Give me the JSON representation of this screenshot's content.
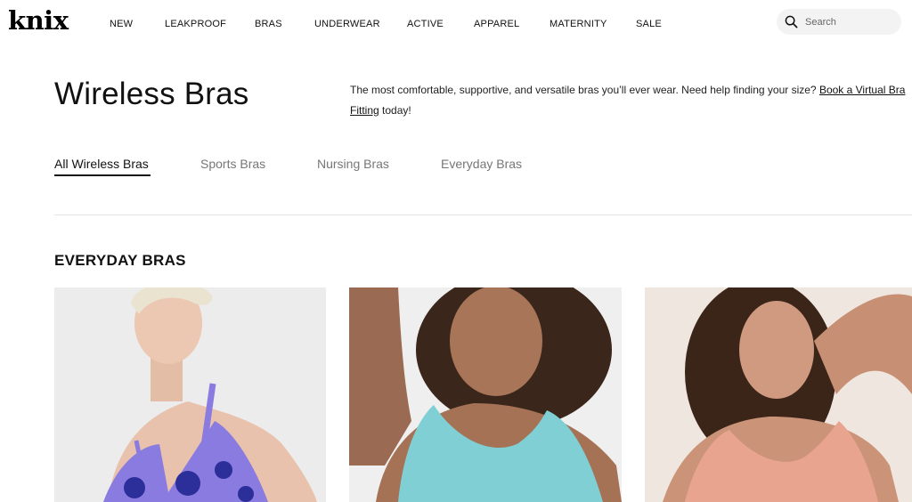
{
  "header": {
    "logo": "knix",
    "nav": [
      "NEW",
      "LEAKPROOF",
      "BRAS",
      "UNDERWEAR",
      "ACTIVE",
      "APPAREL",
      "MATERNITY",
      "SALE"
    ],
    "search": {
      "placeholder": "Search",
      "icon": "search-icon"
    }
  },
  "page": {
    "title": "Wireless Bras",
    "description_prefix": "The most comfortable, supportive, and versatile bras you’ll ever wear. Need help finding your size? ",
    "description_link": "Book a Virtual Bra Fitting",
    "description_suffix": " today!"
  },
  "tabs": [
    {
      "label": "All Wireless Bras",
      "active": true
    },
    {
      "label": "Sports Bras",
      "active": false
    },
    {
      "label": "Nursing Bras",
      "active": false
    },
    {
      "label": "Everyday Bras",
      "active": false
    }
  ],
  "section": {
    "heading": "EVERYDAY BRAS"
  },
  "products": [
    {
      "image": "model-in-floral-print-bra",
      "bra_color": "#7b6fd0"
    },
    {
      "image": "model-in-aqua-bra",
      "bra_color": "#7fd0d6"
    },
    {
      "image": "model-in-peach-bra",
      "bra_color": "#e8a08c"
    }
  ]
}
